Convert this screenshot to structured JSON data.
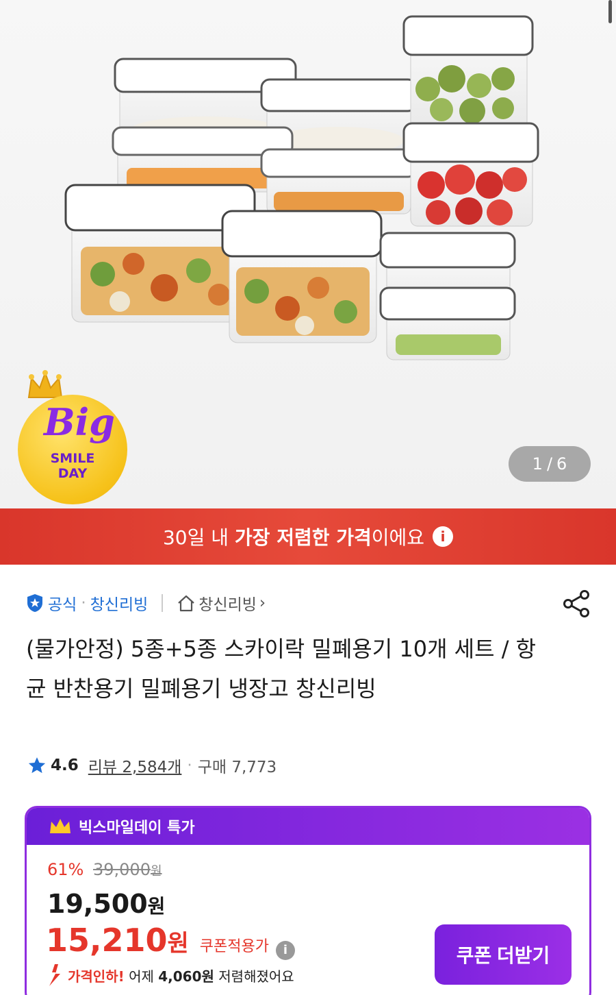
{
  "gallery": {
    "current": "1",
    "separator": "/",
    "total": "6",
    "badge": {
      "top": "Big",
      "line1": "SMILE",
      "line2": "DAY"
    }
  },
  "banner": {
    "pre": "30일 내 ",
    "bold": "가장 저렴한 가격",
    "post": "이에요",
    "info_glyph": "i"
  },
  "seller": {
    "official_label": "공식",
    "dot": "·",
    "brand": "창신리빙",
    "shop_label": "창신리빙",
    "shop_chevron": "›"
  },
  "product": {
    "title": "(물가안정) 5종+5종 스카이락 밀폐용기 10개 세트 / 항균 반찬용기 밀폐용기 냉장고 창신리빙"
  },
  "rating": {
    "score": "4.6",
    "reviews": "리뷰 2,584개",
    "dot": "·",
    "purchases": "구매 7,773"
  },
  "deal": {
    "header": "빅스마일데이 특가",
    "discount_rate": "61%",
    "original_price": "39,000",
    "won_small": "원",
    "price": "19,500",
    "won": "원",
    "coupon_price": "15,210",
    "coupon_label": "쿠폰적용가",
    "info_glyph": "i",
    "drop_highlight": "가격인하!",
    "drop_pre": " 어제 ",
    "drop_amount": "4,060원",
    "drop_post": " 저렴해졌어요",
    "coupon_button": "쿠폰 더받기"
  },
  "colors": {
    "accent_purple": "#8f2de0",
    "banner_red": "#d9362b",
    "price_red": "#e5362b",
    "link_blue": "#1f6ed4"
  },
  "icons": [
    "shield-check-icon",
    "home-icon",
    "share-icon",
    "star-icon",
    "crown-icon",
    "info-icon",
    "arrow-down-icon"
  ]
}
